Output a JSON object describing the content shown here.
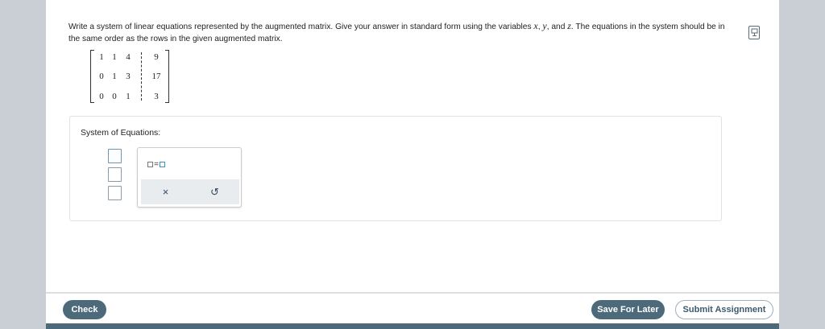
{
  "question": {
    "part1": "Write a system of linear equations represented by the augmented matrix. Give your answer in standard form using the variables ",
    "var_x": "x",
    "sep1": ", ",
    "var_y": "y",
    "sep2": ", and ",
    "var_z": "z",
    "part2": ". The equations in the system should be in the same order as the rows in the given augmented matrix."
  },
  "matrix": {
    "rows": [
      [
        "1",
        "1",
        "4",
        "9"
      ],
      [
        "0",
        "1",
        "3",
        "17"
      ],
      [
        "0",
        "0",
        "1",
        "3"
      ]
    ]
  },
  "answer": {
    "label": "System of Equations:",
    "inputs": [
      "",
      "",
      ""
    ]
  },
  "popup": {
    "template_eq": "=",
    "clear_symbol": "×",
    "undo_symbol": "↺"
  },
  "footer": {
    "check": "Check",
    "save": "Save For Later",
    "submit": "Submit Assignment"
  },
  "icons": {
    "help": "book-help-icon",
    "clear": "close-icon",
    "undo": "undo-icon"
  },
  "colors": {
    "primary": "#4c6a7a",
    "active_input": "#6f96b5",
    "template_blue": "#3a8fc4"
  }
}
